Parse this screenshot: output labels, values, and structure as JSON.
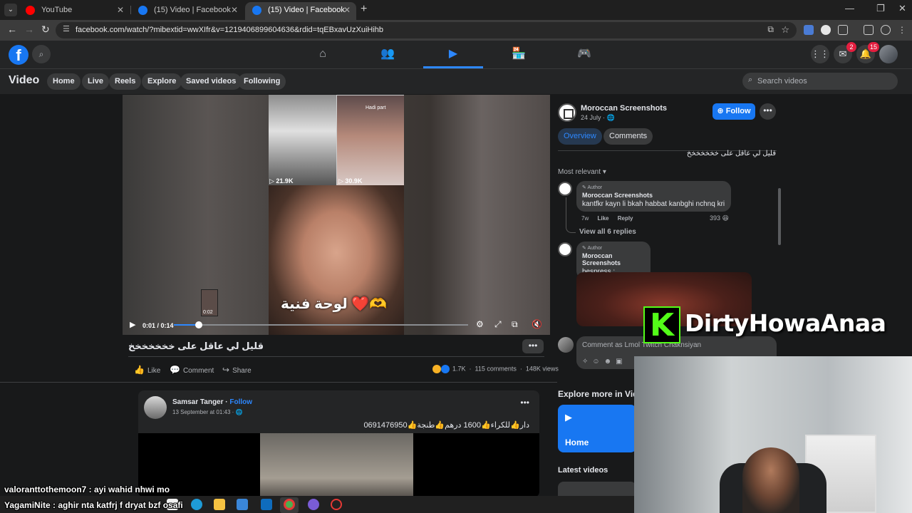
{
  "browser": {
    "tabs": [
      {
        "title": "YouTube",
        "favicon": "youtube-icon",
        "active": false
      },
      {
        "title": "(15) Video | Facebook",
        "favicon": "facebook-icon",
        "active": false
      },
      {
        "title": "(15) Video | Facebook",
        "favicon": "facebook-icon",
        "active": true
      }
    ],
    "url": "facebook.com/watch/?mibextid=wwXIfr&v=1219406899604636&rdid=tqEBxavUzXuiHihb"
  },
  "fb_topbar": {
    "nav": [
      "home-icon",
      "friends-icon",
      "video-icon",
      "marketplace-icon",
      "gaming-icon"
    ],
    "messenger_badge": "2",
    "notifications_badge": "15"
  },
  "subnav": {
    "title": "Video",
    "pills": [
      "Home",
      "Live",
      "Reels",
      "Explore",
      "Saved videos",
      "Following"
    ],
    "search_placeholder": "Search videos"
  },
  "video": {
    "tile_views_1": "21.9K",
    "tile_views_2": "30.9K",
    "tile_label": "Hadi part",
    "caption": "لوحة فنية ❤️🫶",
    "preview_time": "0:02",
    "time": "0:01 / 0:14",
    "progress": 0.085,
    "title": "قليل لي عاقل على خخخخخخخ",
    "actions": {
      "like": "Like",
      "comment": "Comment",
      "share": "Share"
    },
    "reactions": "1.7K",
    "comments_count": "115 comments",
    "views": "148K views"
  },
  "sidepanel": {
    "page_name": "Moroccan Screenshots",
    "date": "24 July ·",
    "follow_label": "Follow",
    "tabs": [
      "Overview",
      "Comments"
    ],
    "description": "قليل لي عاقل على خخخخخخخ",
    "sort_label": "Most relevant",
    "comments": [
      {
        "badge": "Author",
        "name": "Moroccan Screenshots",
        "text": "kantfkr kayn li bkah habbat kanbghi nchnq kri",
        "age": "7w",
        "like": "Like",
        "reply": "Reply",
        "reactions": "393"
      },
      {
        "badge": "Author",
        "name": "Moroccan Screenshots",
        "text": "hespress :"
      }
    ],
    "view_replies": "View all 6 replies",
    "comment_placeholder": "Comment as Lmol Twitch Chaknsiyan"
  },
  "feed_post": {
    "name": "Samsar Tanger",
    "follow": "Follow",
    "date": "13 September at 01:43 ·",
    "text": "دار👍للكراء👍1600 درهم👍طنجة👍0691476950"
  },
  "explore": {
    "title": "Explore more in Video",
    "home_card": "Home",
    "latest": "Latest videos"
  },
  "stream": {
    "channel": "DirtyHowaAnaa",
    "chat": [
      {
        "user": "valoranttothemoon7",
        "msg": " : ayi wahid nhwi mo"
      },
      {
        "user": "YagamiNite",
        "msg": " : aghir nta katfrj f dryat bzf osafi"
      }
    ]
  }
}
